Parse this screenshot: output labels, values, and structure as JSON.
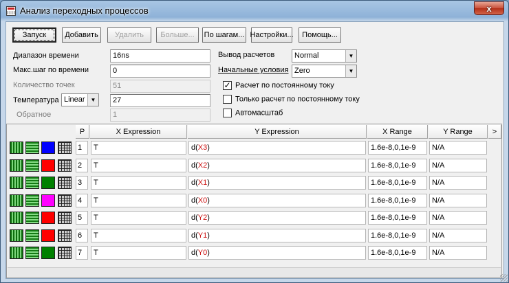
{
  "window": {
    "title": "Анализ переходных процессов",
    "close_glyph": "x"
  },
  "toolbar": {
    "run": "Запуск",
    "add": "Добавить",
    "delete": "Удалить",
    "more": "Больше...",
    "step": "По шагам...",
    "settings": "Настройки...",
    "help": "Помощь..."
  },
  "params": {
    "time_range": {
      "label": "Диапазон времени",
      "value": "16ns"
    },
    "max_step": {
      "label": "Макс.шаг по времени",
      "value": "0"
    },
    "points": {
      "label": "Количество точек",
      "value": "51"
    },
    "temperature": {
      "label": "Температура",
      "mode": "Linear",
      "value": "27"
    },
    "inverse": {
      "label": "Обратное",
      "value": "1"
    }
  },
  "options": {
    "output": {
      "label": "Вывод расчетов",
      "value": "Normal"
    },
    "initial": {
      "label": "Начальные условия",
      "value": "Zero"
    },
    "dc": {
      "label": "Расчет по постоянному току",
      "checked": true
    },
    "dc_only": {
      "label": "Только расчет по постоянному току",
      "checked": false
    },
    "autoscale": {
      "label": "Автомасштаб",
      "checked": false
    }
  },
  "grid": {
    "headers": {
      "p": "P",
      "x_expr": "X Expression",
      "y_expr": "Y Expression",
      "x_range": "X Range",
      "y_range": "Y Range",
      "more": ">"
    },
    "rows": [
      {
        "p": "1",
        "x": "T",
        "y_pre": "d(",
        "y_node": "X3",
        "y_post": ")",
        "x_range": "1.6e-8,0,1e-9",
        "y_range": "N/A",
        "color": "#0000ff"
      },
      {
        "p": "2",
        "x": "T",
        "y_pre": "d(",
        "y_node": "X2",
        "y_post": ")",
        "x_range": "1.6e-8,0,1e-9",
        "y_range": "N/A",
        "color": "#ff0000"
      },
      {
        "p": "3",
        "x": "T",
        "y_pre": "d(",
        "y_node": "X1",
        "y_post": ")",
        "x_range": "1.6e-8,0,1e-9",
        "y_range": "N/A",
        "color": "#008000"
      },
      {
        "p": "4",
        "x": "T",
        "y_pre": "d(",
        "y_node": "X0",
        "y_post": ")",
        "x_range": "1.6e-8,0,1e-9",
        "y_range": "N/A",
        "color": "#ff00ff"
      },
      {
        "p": "5",
        "x": "T",
        "y_pre": "d(",
        "y_node": "Y2",
        "y_post": ")",
        "x_range": "1.6e-8,0,1e-9",
        "y_range": "N/A",
        "color": "#ff0000"
      },
      {
        "p": "6",
        "x": "T",
        "y_pre": "d(",
        "y_node": "Y1",
        "y_post": ")",
        "x_range": "1.6e-8,0,1e-9",
        "y_range": "N/A",
        "color": "#ff0000"
      },
      {
        "p": "7",
        "x": "T",
        "y_pre": "d(",
        "y_node": "Y0",
        "y_post": ")",
        "x_range": "1.6e-8,0,1e-9",
        "y_range": "N/A",
        "color": "#008000"
      }
    ]
  }
}
